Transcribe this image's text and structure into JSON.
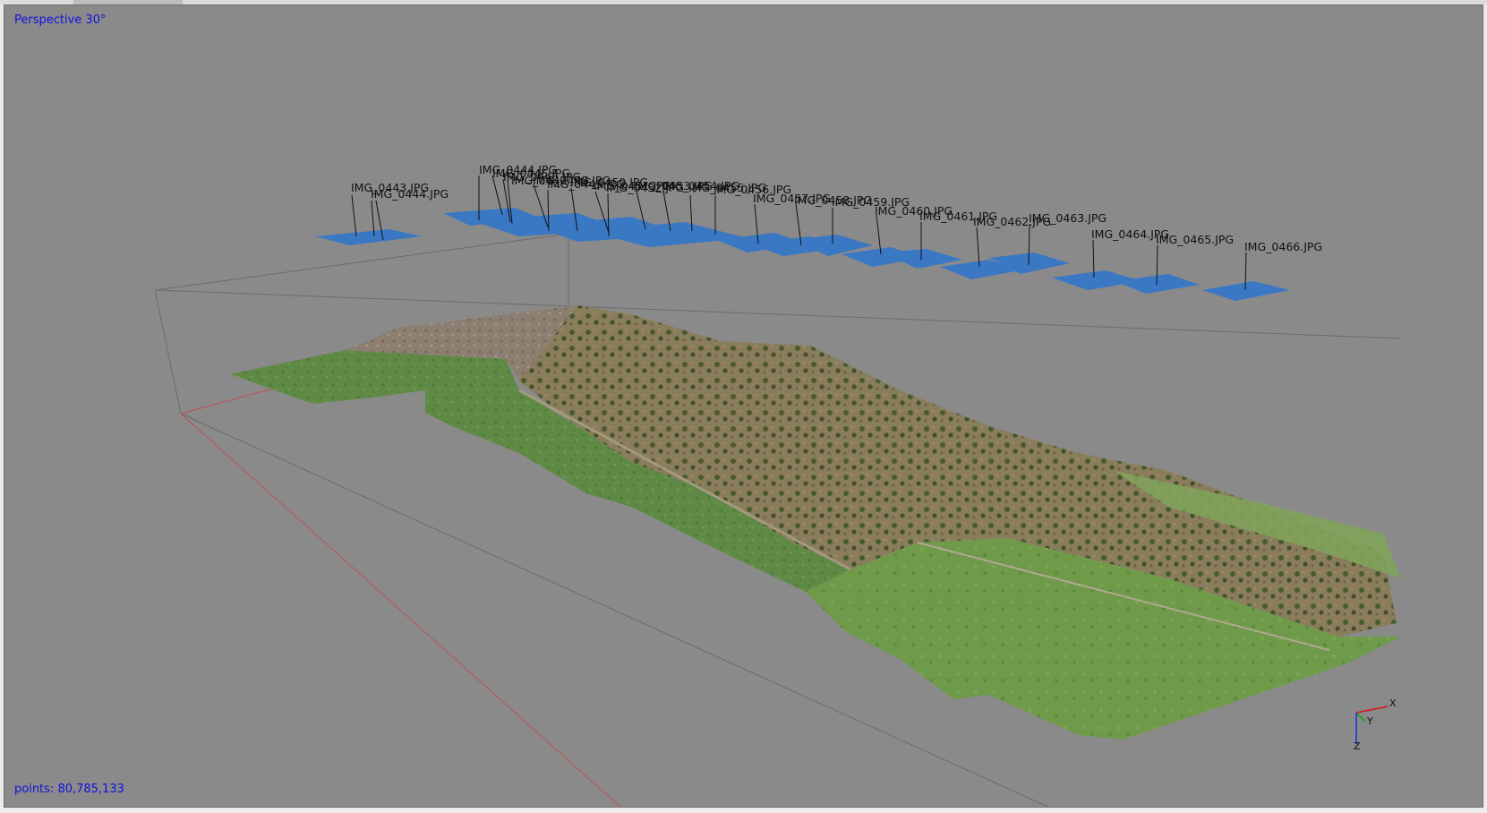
{
  "viewport": {
    "view_mode": "Perspective 30°",
    "point_count_label": "points: 80,785,133"
  },
  "cameras": [
    {
      "id": "IMG_0443",
      "label": "IMG_0443.JPG"
    },
    {
      "id": "IMG_0444",
      "label": "IMG_0444.JPG"
    },
    {
      "id": "IMG_0445",
      "label": "IMG_0444.JPG"
    },
    {
      "id": "IMG_0446",
      "label": "IMG_0445.JPG"
    },
    {
      "id": "IMG_0447",
      "label": "IMG_0446.JPG"
    },
    {
      "id": "IMG_0448",
      "label": "IMG_0447.JPG"
    },
    {
      "id": "IMG_0449",
      "label": "IMG_0448.JPG"
    },
    {
      "id": "IMG_0450",
      "label": "IMG_0449.JPG"
    },
    {
      "id": "IMG_0451",
      "label": "IMG_0450.JPG"
    },
    {
      "id": "IMG_0452",
      "label": "IMG_0451.JPG"
    },
    {
      "id": "IMG_0453",
      "label": "IMG_0452.JPG"
    },
    {
      "id": "IMG_0454",
      "label": "IMG_0453.JPG"
    },
    {
      "id": "IMG_0455",
      "label": "IMG_0454.JPG"
    },
    {
      "id": "IMG_0456",
      "label": "IMG_0455.JPG"
    },
    {
      "id": "IMG_0457",
      "label": "IMG_0456.JPG"
    },
    {
      "id": "IMG_0458",
      "label": "IMG_0457.JPG"
    },
    {
      "id": "IMG_0459",
      "label": "IMG_0458.JPG"
    },
    {
      "id": "IMG_0460",
      "label": "IMG_0459.JPG"
    },
    {
      "id": "IMG_0461",
      "label": "IMG_0460.JPG"
    },
    {
      "id": "IMG_0462",
      "label": "IMG_0461.JPG"
    },
    {
      "id": "IMG_0463",
      "label": "IMG_0462.JPG"
    },
    {
      "id": "IMG_0464",
      "label": "IMG_0463.JPG"
    },
    {
      "id": "IMG_0465",
      "label": "IMG_0464.JPG"
    },
    {
      "id": "IMG_0466",
      "label": "IMG_0465.JPG"
    },
    {
      "id": "IMG_0467",
      "label": "IMG_0466.JPG"
    }
  ],
  "axes": {
    "x": "X",
    "y": "Y",
    "z": "Z"
  },
  "colors": {
    "background": "#8a8a8a",
    "camera_plane": "#3a78c4",
    "overlay_text": "#1010e0",
    "axis_x": "#d02020",
    "axis_y": "#20a020",
    "axis_z": "#2040d0"
  }
}
